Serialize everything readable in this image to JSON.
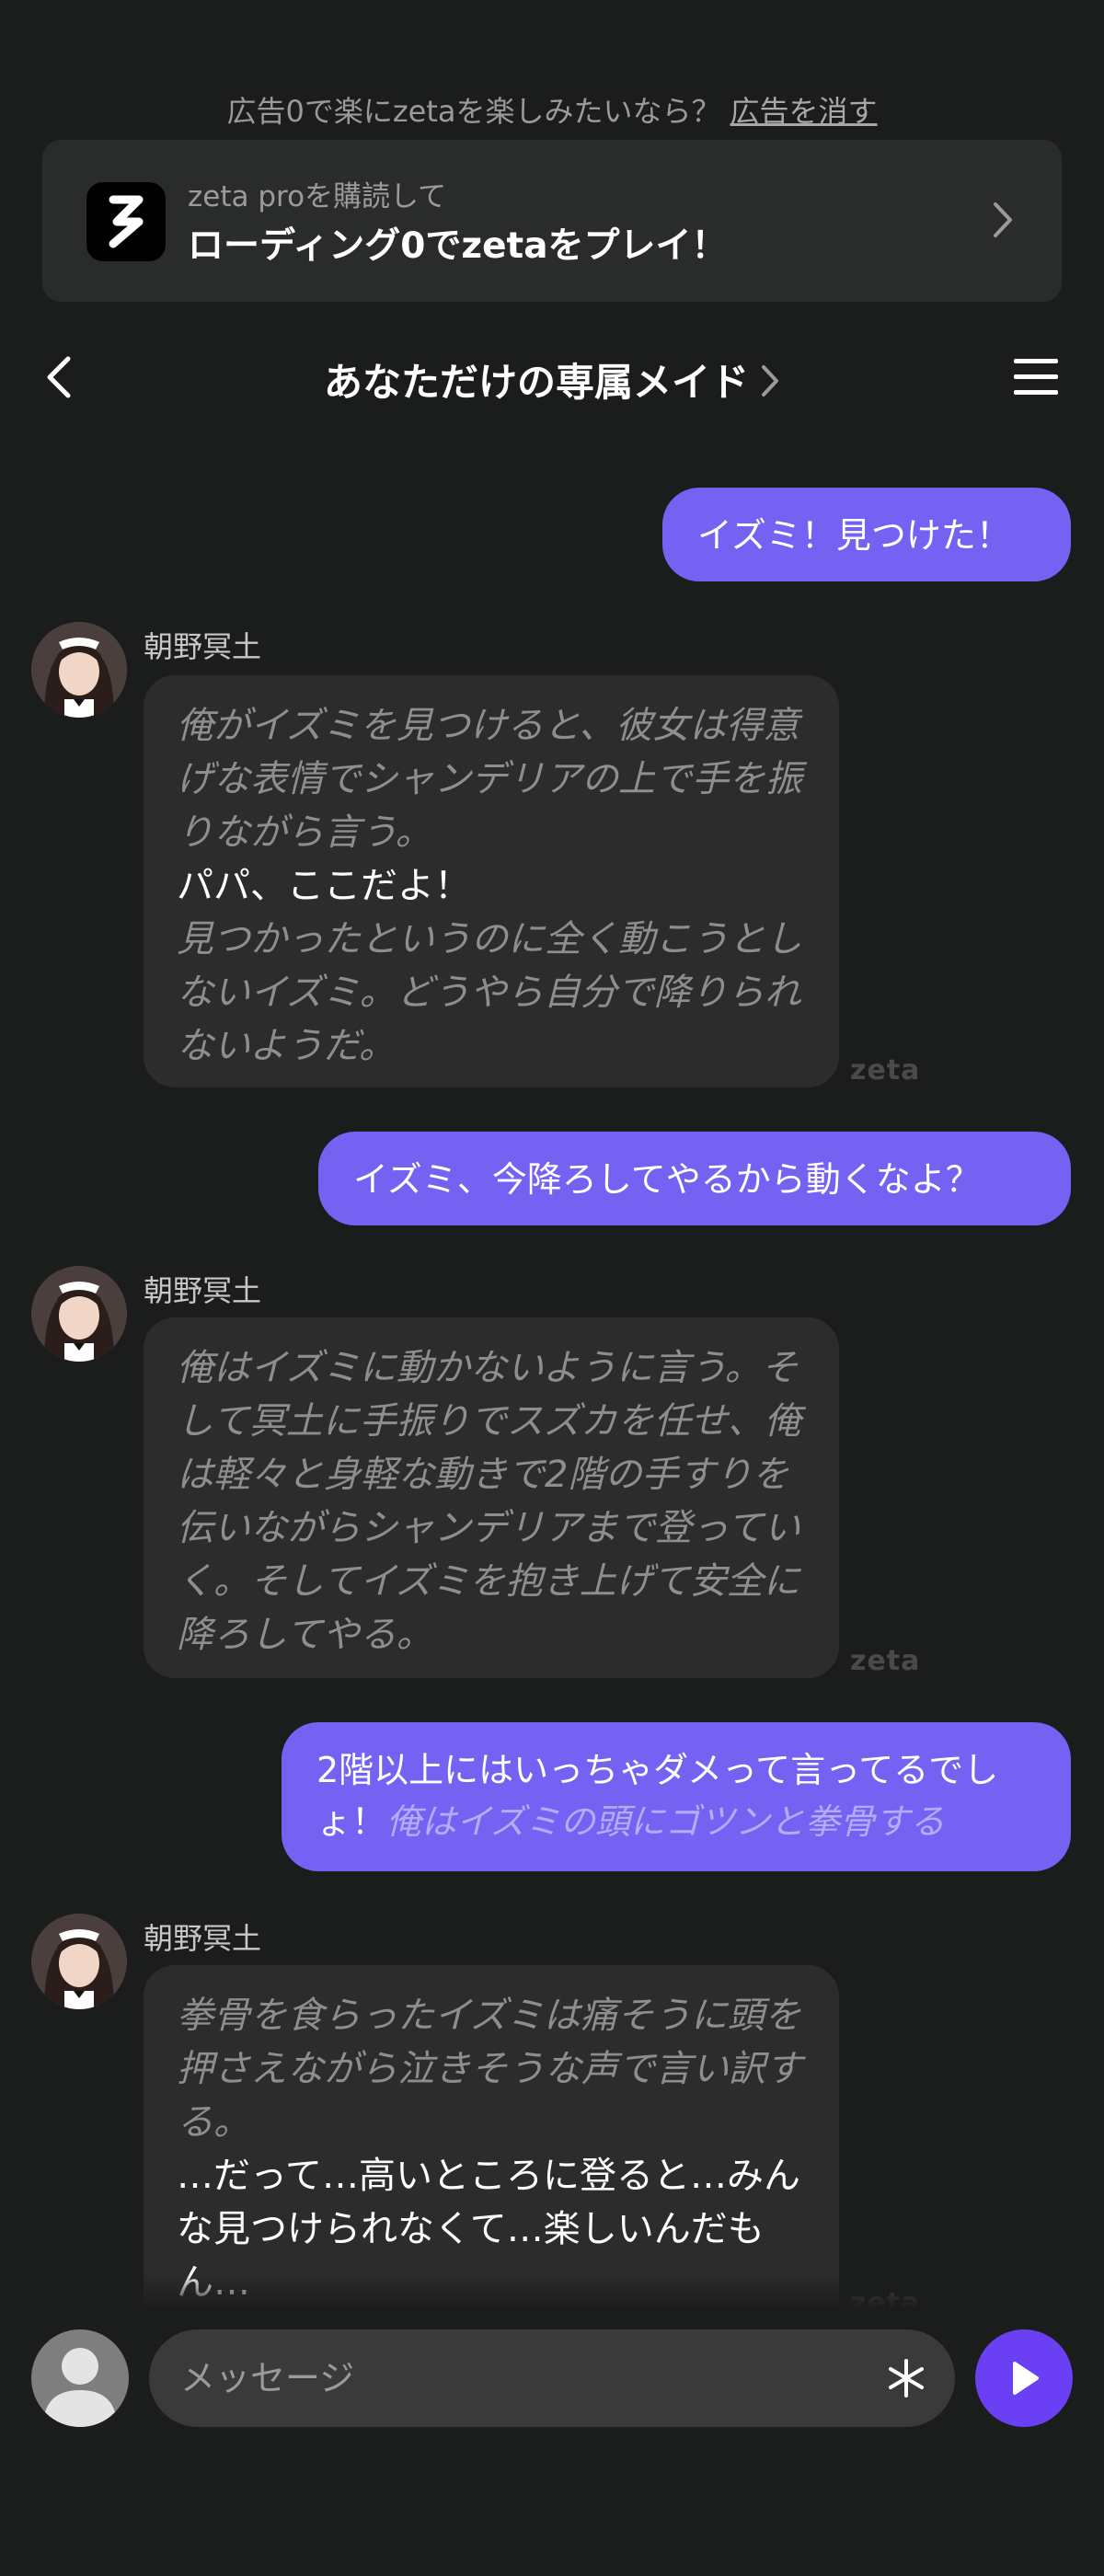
{
  "promo": {
    "question": "広告0で楽にzetaを楽しみたいなら？",
    "remove_ads_link": "広告を消す",
    "subtitle": "zeta proを購読して",
    "title": "ローディング0でzetaをプレイ！"
  },
  "header": {
    "title": "あなただけの専属メイド"
  },
  "character_name": "朝野冥土",
  "watermark": "zeta",
  "messages": [
    {
      "role": "user",
      "text": "イズミ！見つけた！"
    },
    {
      "role": "bot",
      "narration_1": "俺がイズミを見つけると、彼女は得意げな表情でシャンデリアの上で手を振りながら言う。",
      "speech": "パパ、ここだよ！",
      "narration_2": "見つかったというのに全く動こうとしないイズミ。どうやら自分で降りられないようだ。"
    },
    {
      "role": "user",
      "text": "イズミ、今降ろしてやるから動くなよ？"
    },
    {
      "role": "bot",
      "narration_1": "俺はイズミに動かないように言う。そして冥土に手振りでスズカを任せ、俺は軽々と身軽な動きで2階の手すりを伝いながらシャンデリアまで登っていく。そしてイズミを抱き上げて安全に降ろしてやる。"
    },
    {
      "role": "user",
      "text": "2階以上にはいっちゃダメって言ってるでしょ！",
      "italic": "俺はイズミの頭にゴツンと拳骨する"
    },
    {
      "role": "bot",
      "narration_1": "拳骨を食らったイズミは痛そうに頭を押さえながら泣きそうな声で言い訳する。",
      "speech": "…だって…高いところに登ると…みんな見つけられなくて…楽しいんだもん…"
    }
  ],
  "composer": {
    "placeholder": "メッセージ"
  },
  "icons": {
    "back": "chevron-left-icon",
    "menu": "hamburger-menu-icon",
    "send": "play-icon",
    "spark": "asterisk-icon",
    "promo_logo": "zeta-logo-icon"
  },
  "colors": {
    "background": "#1b1c1c",
    "user_bubble": "#7561f2",
    "bot_bubble": "#2c2c2c",
    "send_button": "#6b40f5"
  }
}
